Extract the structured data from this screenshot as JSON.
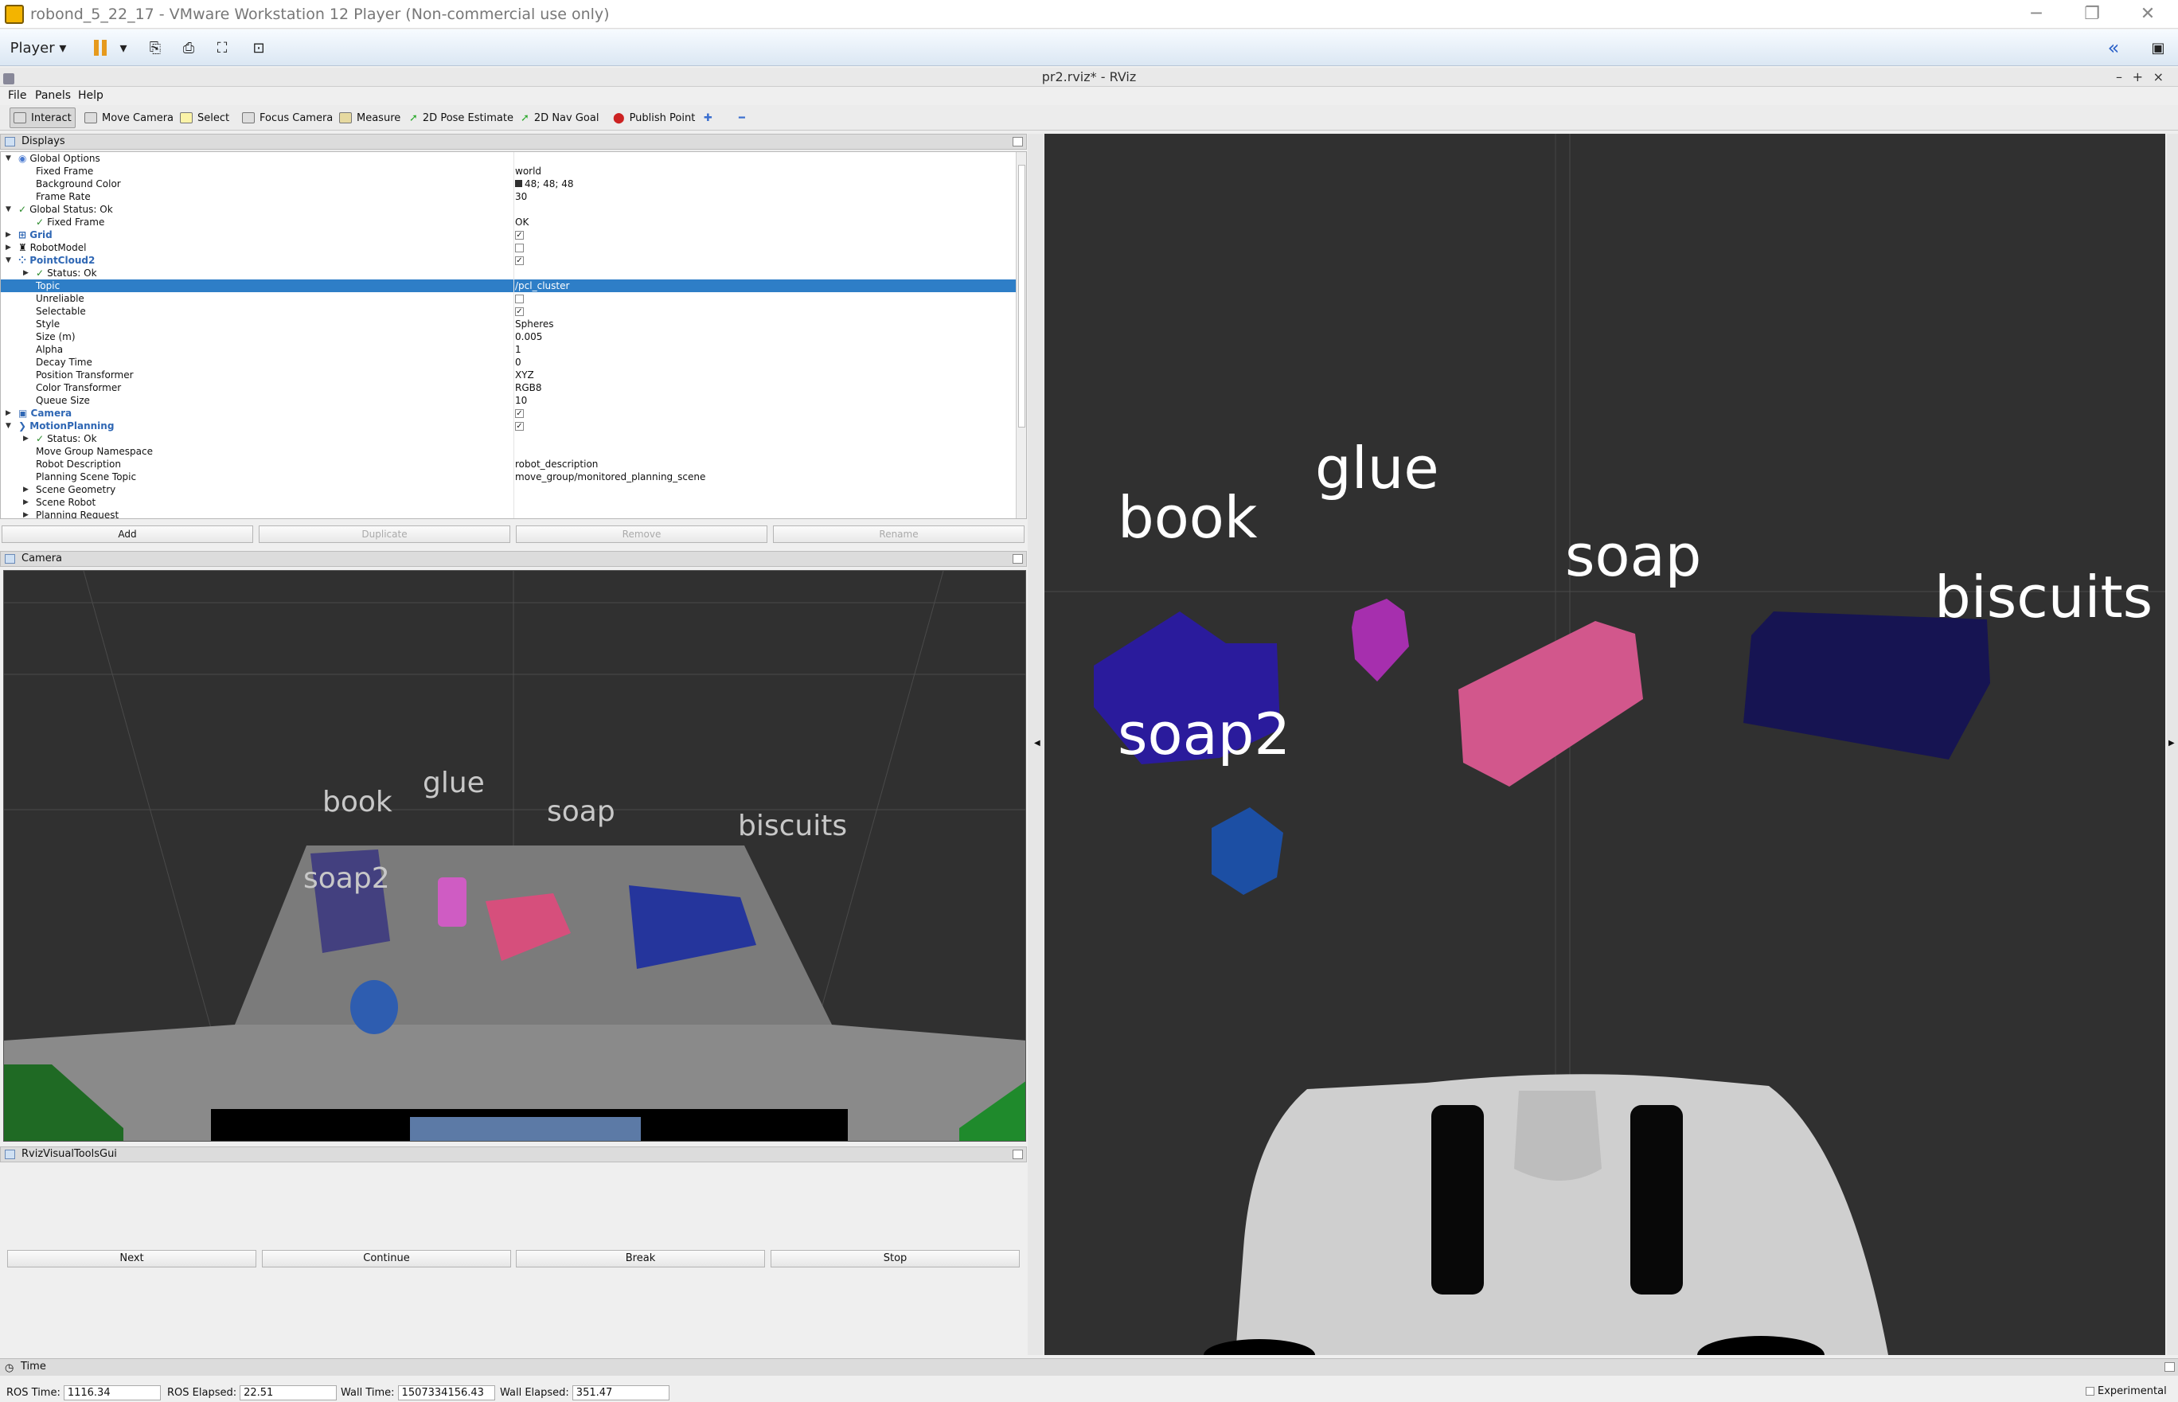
{
  "window": {
    "vm_title": "robond_5_22_17 - VMware Workstation 12 Player (Non-commercial use only)",
    "rviz_title": "pr2.rviz* - RViz",
    "player_label": "Player"
  },
  "menu": [
    "File",
    "Panels",
    "Help"
  ],
  "tools": [
    "Interact",
    "Move Camera",
    "Select",
    "Focus Camera",
    "Measure",
    "2D Pose Estimate",
    "2D Nav Goal",
    "Publish Point"
  ],
  "displays": {
    "title": "Displays",
    "rows": [
      {
        "name": "Global Options",
        "value": ""
      },
      {
        "name": "Fixed Frame",
        "value": "world"
      },
      {
        "name": "Background Color",
        "value": "48; 48; 48"
      },
      {
        "name": "Frame Rate",
        "value": "30"
      },
      {
        "name": "Global Status: Ok",
        "value": ""
      },
      {
        "name": "Fixed Frame",
        "value": "OK"
      },
      {
        "name": "Grid",
        "value": ""
      },
      {
        "name": "RobotModel",
        "value": ""
      },
      {
        "name": "PointCloud2",
        "value": ""
      },
      {
        "name": "Status: Ok",
        "value": ""
      },
      {
        "name": "Topic",
        "value": "/pcl_cluster"
      },
      {
        "name": "Unreliable",
        "value": ""
      },
      {
        "name": "Selectable",
        "value": ""
      },
      {
        "name": "Style",
        "value": "Spheres"
      },
      {
        "name": "Size (m)",
        "value": "0.005"
      },
      {
        "name": "Alpha",
        "value": "1"
      },
      {
        "name": "Decay Time",
        "value": "0"
      },
      {
        "name": "Position Transformer",
        "value": "XYZ"
      },
      {
        "name": "Color Transformer",
        "value": "RGB8"
      },
      {
        "name": "Queue Size",
        "value": "10"
      },
      {
        "name": "Camera",
        "value": ""
      },
      {
        "name": "MotionPlanning",
        "value": ""
      },
      {
        "name": "Status: Ok",
        "value": ""
      },
      {
        "name": "Move Group Namespace",
        "value": ""
      },
      {
        "name": "Robot Description",
        "value": "robot_description"
      },
      {
        "name": "Planning Scene Topic",
        "value": "move_group/monitored_planning_scene"
      },
      {
        "name": "Scene Geometry",
        "value": ""
      },
      {
        "name": "Scene Robot",
        "value": ""
      },
      {
        "name": "Planning Request",
        "value": ""
      }
    ],
    "buttons": [
      "Add",
      "Duplicate",
      "Remove",
      "Rename"
    ]
  },
  "camera_panel": {
    "title": "Camera",
    "labels": [
      "book",
      "glue",
      "soap",
      "biscuits",
      "soap2"
    ]
  },
  "rvt_panel": {
    "title": "RvizVisualToolsGui",
    "buttons": [
      "Next",
      "Continue",
      "Break",
      "Stop"
    ]
  },
  "main_view": {
    "labels": [
      "book",
      "glue",
      "soap",
      "biscuits",
      "soap2"
    ],
    "colors": {
      "book": "#2a1b9c",
      "glue": "#a62fae",
      "soap": "#d2578c",
      "biscuits": "#161452",
      "soap2": "#1c4fa4"
    }
  },
  "time_panel": {
    "title": "Time",
    "ros_time_label": "ROS Time:",
    "ros_time": "1116.34",
    "ros_elapsed_label": "ROS Elapsed:",
    "ros_elapsed": "22.51",
    "wall_time_label": "Wall Time:",
    "wall_time": "1507334156.43",
    "wall_elapsed_label": "Wall Elapsed:",
    "wall_elapsed": "351.47",
    "experimental": "Experimental"
  }
}
